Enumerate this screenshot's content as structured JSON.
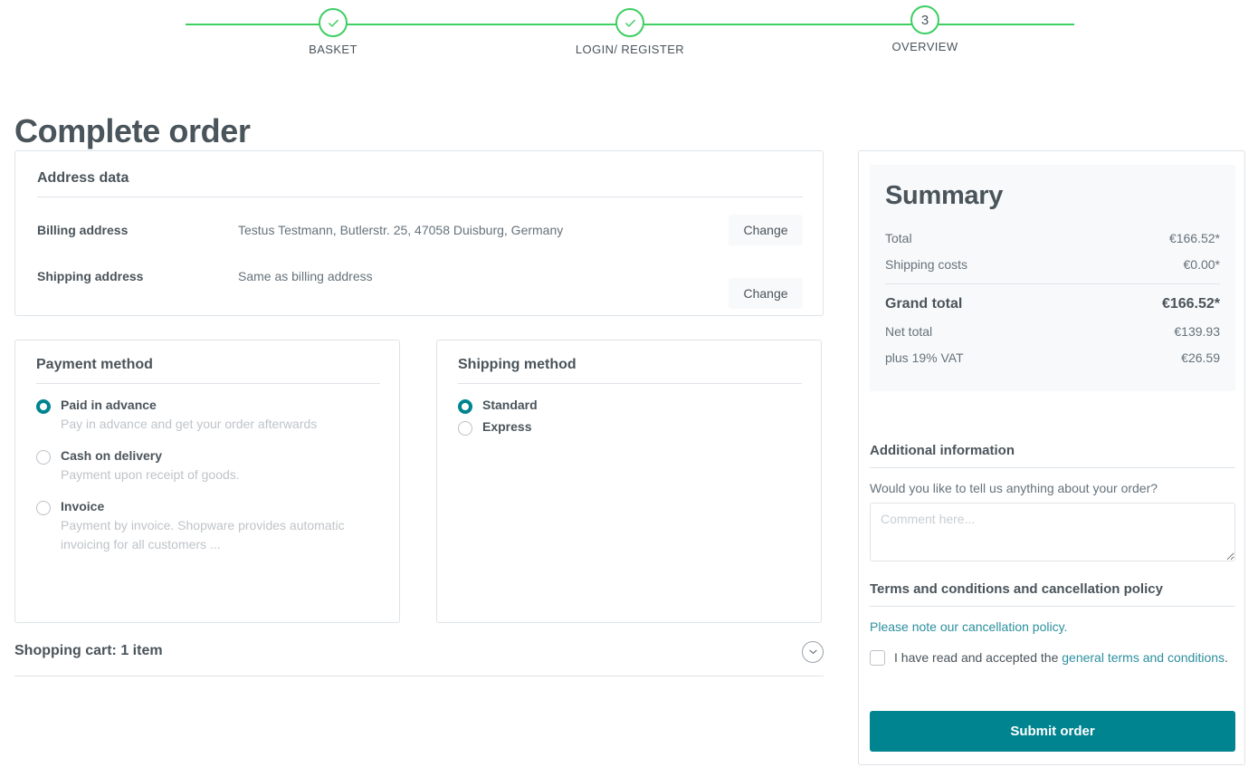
{
  "steps": {
    "items": [
      {
        "label": "BASKET",
        "state": "done",
        "marker": "check-icon"
      },
      {
        "label": "LOGIN/ REGISTER",
        "state": "done",
        "marker": "check-icon"
      },
      {
        "label": "OVERVIEW",
        "state": "current",
        "marker": "3"
      }
    ],
    "accent_color": "#3ecf63"
  },
  "page": {
    "title": "Complete order"
  },
  "address": {
    "title": "Address data",
    "billing": {
      "label": "Billing address",
      "value": "Testus Testmann, Butlerstr. 25, 47058 Duisburg, Germany",
      "change_label": "Change"
    },
    "shipping": {
      "label": "Shipping address",
      "value": "Same as billing address",
      "change_label": "Change"
    }
  },
  "payment": {
    "title": "Payment method",
    "options": [
      {
        "name": "Paid in advance",
        "desc": "Pay in advance and get your order afterwards",
        "selected": true
      },
      {
        "name": "Cash on delivery",
        "desc": "Payment upon receipt of goods.",
        "selected": false
      },
      {
        "name": "Invoice",
        "desc": "Payment by invoice. Shopware provides automatic invoicing for all customers ...",
        "selected": false
      }
    ]
  },
  "shipping_method": {
    "title": "Shipping method",
    "options": [
      {
        "name": "Standard",
        "selected": true
      },
      {
        "name": "Express",
        "selected": false
      }
    ]
  },
  "cart_bar": {
    "title": "Shopping cart: 1 item",
    "toggle_icon": "chevron-down-icon"
  },
  "summary": {
    "title": "Summary",
    "rows": [
      {
        "label": "Total",
        "value": "€166.52*"
      },
      {
        "label": "Shipping costs",
        "value": "€0.00*"
      }
    ],
    "grand": {
      "label": "Grand total",
      "value": "€166.52*"
    },
    "rows_after": [
      {
        "label": "Net total",
        "value": "€139.93"
      },
      {
        "label": "plus 19% VAT",
        "value": "€26.59"
      }
    ]
  },
  "additional": {
    "title": "Additional information",
    "question": "Would you like to tell us anything about your order?",
    "comment_value": "",
    "comment_placeholder": "Comment here..."
  },
  "terms": {
    "title": "Terms and conditions and cancellation policy",
    "cancellation_link": "Please note our cancellation policy.",
    "accept_prefix": "I have read and accepted the ",
    "accept_link": "general terms and conditions",
    "accept_suffix": ".",
    "checked": false
  },
  "actions": {
    "submit_label": "Submit order"
  },
  "colors": {
    "accent_teal": "#008490",
    "link_teal": "#2c8f9e",
    "progress_green": "#3ecf63",
    "text_dark": "#4a545b",
    "text_muted": "#bfc4c9",
    "border": "#dfe3e8",
    "panel_bg": "#f8f9fa"
  }
}
